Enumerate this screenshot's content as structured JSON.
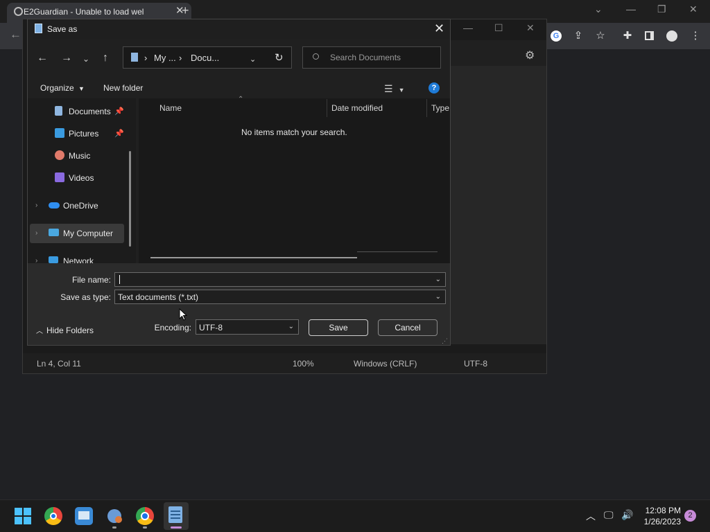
{
  "browser": {
    "tab_title": "E2Guardian - Unable to load wel",
    "tab_close": "✕",
    "new_tab": "+",
    "window_controls": [
      "⌄",
      "—",
      "❐",
      "✕"
    ],
    "toolbar_icons": [
      "google-icon",
      "share-icon",
      "star-icon",
      "extensions-icon",
      "sidebar-icon",
      "profile-icon",
      "menu-icon"
    ]
  },
  "notepad": {
    "status": {
      "position": "Ln 4, Col 11",
      "zoom": "100%",
      "line_ending": "Windows (CRLF)",
      "encoding": "UTF-8"
    }
  },
  "dialog": {
    "title": "Save as",
    "address": {
      "segments": [
        "My ...",
        "Docu..."
      ],
      "separator": "›"
    },
    "search_placeholder": "Search Documents",
    "commands": {
      "organize": "Organize",
      "new_folder": "New folder"
    },
    "nav_items": [
      {
        "label": "Documents",
        "pinned": true,
        "color": "#8fb6e0"
      },
      {
        "label": "Pictures",
        "pinned": true,
        "color": "#3a9be0"
      },
      {
        "label": "Music",
        "pinned": false,
        "color": "#e07a6a"
      },
      {
        "label": "Videos",
        "pinned": false,
        "color": "#8a6ae0"
      },
      {
        "label": "OneDrive",
        "pinned": false,
        "color": "#2f8ef0"
      },
      {
        "label": "My Computer",
        "pinned": false,
        "color": "#4aa8e0"
      },
      {
        "label": "Network",
        "pinned": false,
        "color": "#3a9be0"
      }
    ],
    "columns": [
      "Name",
      "Date modified",
      "Type"
    ],
    "empty_message": "No items match your search.",
    "file_name_label": "File name:",
    "file_name_value": "",
    "save_type_label": "Save as type:",
    "save_type_value": "Text documents (*.txt)",
    "hide_folders": "Hide Folders",
    "encoding_label": "Encoding:",
    "encoding_value": "UTF-8",
    "save_button": "Save",
    "cancel_button": "Cancel",
    "help": "?"
  },
  "taskbar": {
    "time": "12:08 PM",
    "date": "1/26/2023",
    "notification_count": "2"
  },
  "colors": {
    "accent": "#1e7ad6",
    "dialog_bg": "#202020",
    "taskbar_bg": "#1c1c1c"
  }
}
